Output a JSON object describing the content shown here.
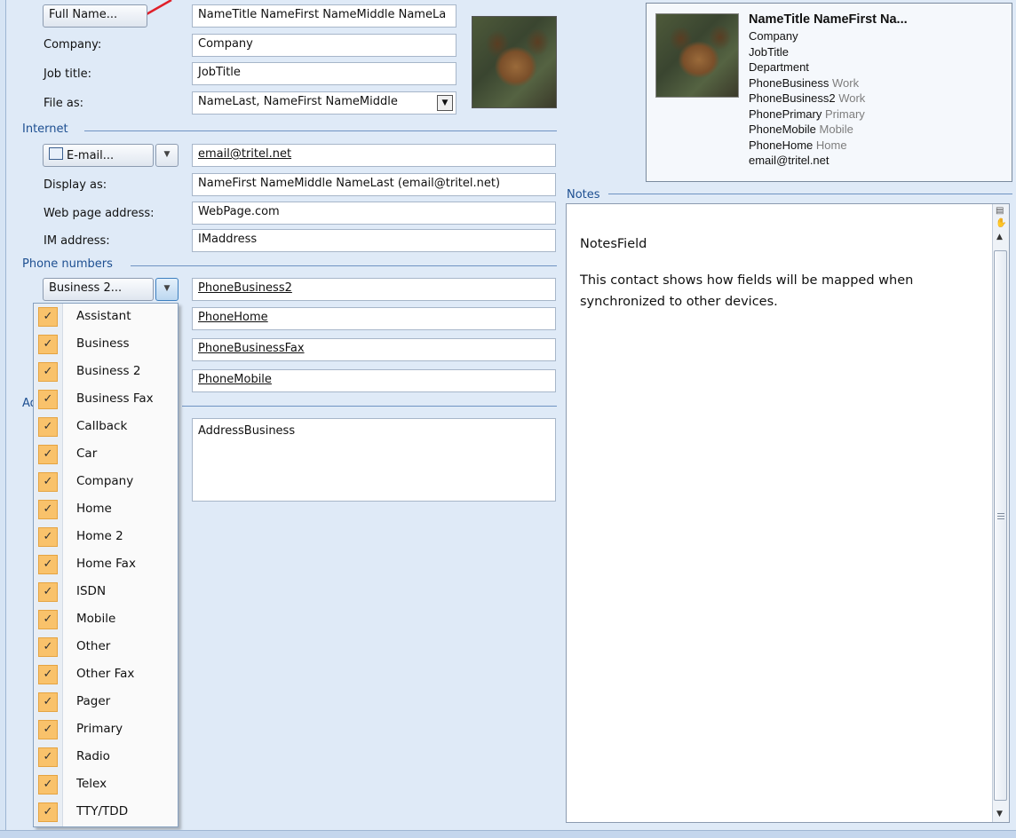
{
  "name": {
    "full_name_button": "Full Name...",
    "full_name_value": "NameTitle NameFirst NameMiddle NameLa",
    "company_label": "Company:",
    "company_value": "Company",
    "job_title_label": "Job title:",
    "job_title_value": "JobTitle",
    "file_as_label": "File as:",
    "file_as_value": "NameLast, NameFirst NameMiddle"
  },
  "internet": {
    "section_title": "Internet",
    "email_button": "E-mail...",
    "email_value": "email@tritel.net",
    "display_as_label": "Display as:",
    "display_as_value": "NameFirst NameMiddle NameLast (email@tritel.net)",
    "web_label": "Web page address:",
    "web_value": "WebPage.com",
    "im_label": "IM address:",
    "im_value": "IMaddress"
  },
  "phones": {
    "section_title": "Phone numbers",
    "phone_button": "Business 2...",
    "values": [
      "PhoneBusiness2",
      "PhoneHome",
      "PhoneBusinessFax",
      "PhoneMobile"
    ]
  },
  "addresses": {
    "section_title": "Ad",
    "address_value": "AddressBusiness"
  },
  "card": {
    "title": "NameTitle NameFirst Na...",
    "company": "Company",
    "job_title": "JobTitle",
    "department": "Department",
    "phones": [
      {
        "value": "PhoneBusiness",
        "type": "Work"
      },
      {
        "value": "PhoneBusiness2",
        "type": "Work"
      },
      {
        "value": "PhonePrimary",
        "type": "Primary"
      },
      {
        "value": "PhoneMobile",
        "type": "Mobile"
      },
      {
        "value": "PhoneHome",
        "type": "Home"
      }
    ],
    "email": "email@tritel.net"
  },
  "notes": {
    "section_title": "Notes",
    "line1": "NotesField",
    "line2": "This contact shows how fields will be mapped when synchronized to other devices."
  },
  "phone_type_menu": {
    "items": [
      "Assistant",
      "Business",
      "Business 2",
      "Business Fax",
      "Callback",
      "Car",
      "Company",
      "Home",
      "Home 2",
      "Home Fax",
      "ISDN",
      "Mobile",
      "Other",
      "Other Fax",
      "Pager",
      "Primary",
      "Radio",
      "Telex",
      "TTY/TDD"
    ]
  },
  "colors": {
    "accent": "#1d4f91",
    "check": "#f9c26b",
    "annotation_arrow": "#e0202a"
  },
  "icons": {
    "address_book": "address-book-icon",
    "check": "checkmark-icon",
    "dropdown": "chevron-down-icon"
  }
}
